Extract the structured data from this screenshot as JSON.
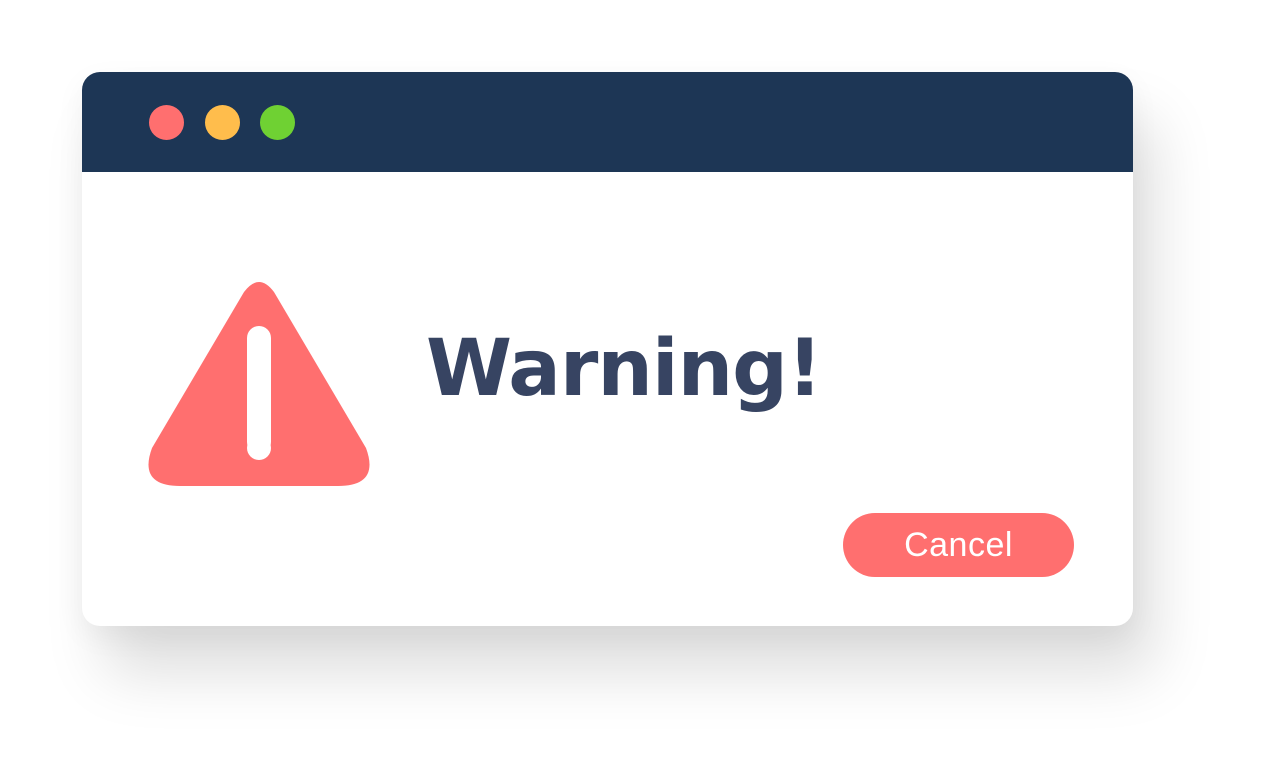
{
  "window": {
    "controls": [
      {
        "name": "close",
        "color": "#ff6f6f"
      },
      {
        "name": "minimize",
        "color": "#ffbd4c"
      },
      {
        "name": "maximize",
        "color": "#6fd133"
      }
    ],
    "titlebar_color": "#1d3655"
  },
  "dialog": {
    "icon": "warning-triangle-icon",
    "icon_color": "#ff6f6f",
    "title": "Warning!",
    "title_color": "#374462",
    "cancel_label": "Cancel",
    "cancel_color": "#ff6f6f"
  }
}
